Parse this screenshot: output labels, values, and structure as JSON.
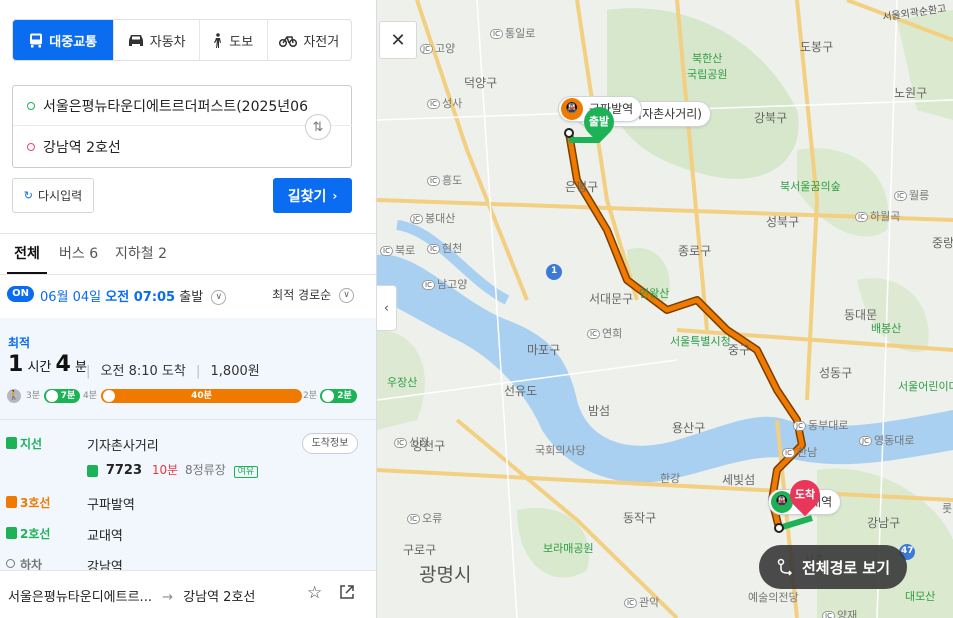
{
  "modes": [
    {
      "label": "대중교통",
      "icon": "bus-icon",
      "active": true
    },
    {
      "label": "자동차",
      "icon": "car-icon",
      "active": false
    },
    {
      "label": "도보",
      "icon": "walk-icon",
      "active": false
    },
    {
      "label": "자전거",
      "icon": "bicycle-icon",
      "active": false
    }
  ],
  "route": {
    "origin": "서울은평뉴타운디에트르더퍼스트(2025년06",
    "destination": "강남역 2호선",
    "swap_icon": "swap-icon"
  },
  "buttons": {
    "reset": "다시입력",
    "search": "길찾기"
  },
  "tabs": [
    {
      "label": "전체",
      "active": true
    },
    {
      "label": "버스 6",
      "active": false
    },
    {
      "label": "지하철 2",
      "active": false
    }
  ],
  "departure": {
    "badge": "ON",
    "date": "06월 04일",
    "time": "오전 07:05",
    "suffix": "출발",
    "sort": "최적 경로순"
  },
  "result": {
    "label": "최적",
    "hours": "1",
    "hours_unit": "시간",
    "minutes": "4",
    "minutes_unit": "분",
    "arrival": "오전 8:10 도착",
    "fare": "1,800원",
    "segments": [
      {
        "type": "walk",
        "label": "3분"
      },
      {
        "type": "bus",
        "label": "7분"
      },
      {
        "type": "walk",
        "label": "4분"
      },
      {
        "type": "subway-line3",
        "label": "40분"
      },
      {
        "type": "walk",
        "label": "2분"
      },
      {
        "type": "subway-line2",
        "label": "2분"
      }
    ],
    "steps": [
      {
        "kind": "지선",
        "name": "기자촌사거리",
        "color": "#1db256"
      },
      {
        "kind": "3호선",
        "name": "구파발역",
        "color": "#f07900"
      },
      {
        "kind": "2호선",
        "name": "교대역",
        "color": "#1db256"
      },
      {
        "kind": "하차",
        "name": "강남역",
        "color": "#777777"
      }
    ],
    "arrival_info": "도착정보",
    "bus": {
      "number": "7723",
      "minutes": "10분",
      "stops": "8정류장",
      "status": "여유"
    }
  },
  "footer": {
    "from": "서울은평뉴타운디에트르...",
    "to": "강남역 2호선",
    "star_icon": "star-icon",
    "share_icon": "share-icon"
  },
  "map": {
    "labels": {
      "goyang": "고양",
      "tonggileo": "통일로",
      "deokyang": "덕양구",
      "bukhansan": "북한산",
      "bukhansan_park": "국립공원",
      "dobong": "도봉구",
      "nowon": "노원구",
      "gangbuk": "강북구",
      "seongsa": "성사",
      "heungdo": "흥도",
      "bongdaesan": "봉대산",
      "hyeoncheon": "현천",
      "bukro": "북로",
      "eunpyeong": "은평구",
      "bukseoul": "북서울꿈의숲",
      "wolleung": "월릉",
      "hawolgok": "하월곡",
      "seongbuk": "성북구",
      "jongno": "종로구",
      "jungrang": "중랑",
      "namgoyang": "남고양",
      "inwangsan": "인왕산",
      "seodaemun": "서대문구",
      "dongdaemun": "동대문",
      "baebongsan": "배봉산",
      "yeonhui": "연희",
      "mapo": "마포구",
      "seoul_cityhall": "서울특별시청",
      "junggu": "중구",
      "seongdong": "성동구",
      "usangsan": "우장산",
      "seonyudo": "선유도",
      "bamseom": "밤섬",
      "yongsan": "용산구",
      "dongbudae": "동부대로",
      "seoul_children_park": "서울어린이대공원",
      "sinjeong": "신정",
      "yangcheon": "양천구",
      "national_assembly": "국회의사당",
      "hannam": "한남",
      "yeongdong": "영동대로",
      "hangang": "한강",
      "sebit": "세빛섬",
      "dongjak": "동작구",
      "gangnam": "강남구",
      "ori": "오류",
      "boramae": "보라매공원",
      "guro": "구로구",
      "gwangmyeong": "광명시",
      "seocho": "서초",
      "arts_center": "예술의전당",
      "gwanak": "관악",
      "yangjae": "양재",
      "daemosan": "대모산",
      "lotte": "롯",
      "road_1": "1",
      "road_47": "47",
      "expressway": "서울외곽순환고"
    },
    "callouts": {
      "start_station": "구파발역",
      "bus_stop": "7723 (기자촌사거리)",
      "start_marker": "출발",
      "end_marker": "도착",
      "end_station": "교대역"
    },
    "full_route_button": "전체경로 보기",
    "close_icon": "close-icon",
    "collapse_icon": "chevron-left-icon",
    "route_colors": {
      "subway_line3": "#f07900",
      "bus": "#1db256",
      "subway_line2": "#1db256"
    }
  }
}
